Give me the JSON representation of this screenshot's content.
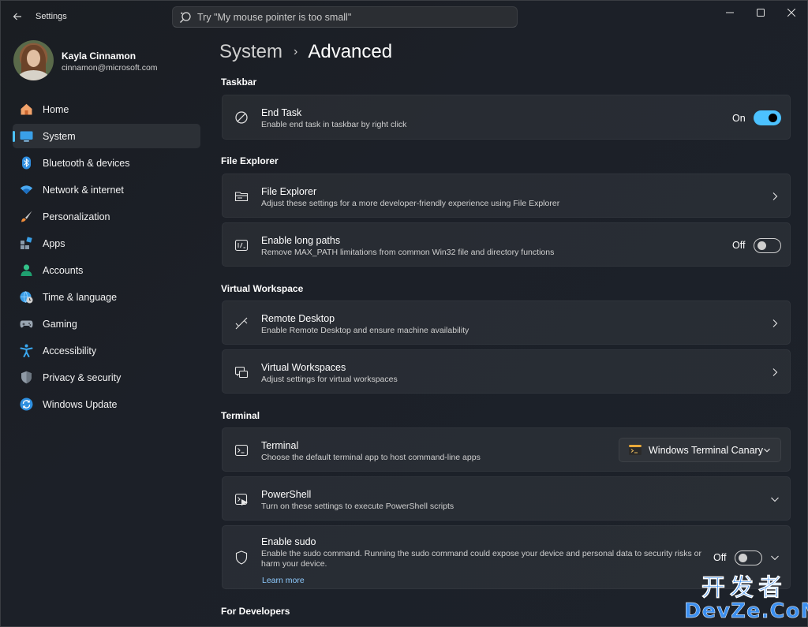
{
  "app": {
    "title": "Settings",
    "back_icon": "back-arrow-icon",
    "window_controls": [
      "minimize-icon",
      "maximize-icon",
      "close-icon"
    ]
  },
  "search": {
    "placeholder": "Try \"My mouse pointer is too small\"",
    "value": "",
    "icon": "search-icon"
  },
  "user": {
    "name": "Kayla Cinnamon",
    "email": "cinnamon@microsoft.com"
  },
  "nav": {
    "selected": "System",
    "items": [
      {
        "label": "Home",
        "icon": "home-icon"
      },
      {
        "label": "System",
        "icon": "system-display-icon"
      },
      {
        "label": "Bluetooth & devices",
        "icon": "bluetooth-icon"
      },
      {
        "label": "Network & internet",
        "icon": "wifi-icon"
      },
      {
        "label": "Personalization",
        "icon": "paintbrush-icon"
      },
      {
        "label": "Apps",
        "icon": "apps-icon"
      },
      {
        "label": "Accounts",
        "icon": "accounts-icon"
      },
      {
        "label": "Time & language",
        "icon": "globe-clock-icon"
      },
      {
        "label": "Gaming",
        "icon": "gamepad-icon"
      },
      {
        "label": "Accessibility",
        "icon": "accessibility-icon"
      },
      {
        "label": "Privacy & security",
        "icon": "shield-icon"
      },
      {
        "label": "Windows Update",
        "icon": "windows-update-icon"
      }
    ]
  },
  "breadcrumb": {
    "parent": "System",
    "separator": "›",
    "current": "Advanced"
  },
  "sections": {
    "taskbar": "Taskbar",
    "file_explorer": "File Explorer",
    "virtual_workspace": "Virtual Workspace",
    "terminal": "Terminal",
    "for_developers": "For Developers"
  },
  "cards": {
    "end_task": {
      "title": "End Task",
      "desc": "Enable end task in taskbar by right click",
      "state": "On",
      "on": true
    },
    "file_explorer": {
      "title": "File Explorer",
      "desc": "Adjust these settings for a more developer-friendly experience using File Explorer"
    },
    "long_paths": {
      "title": "Enable long paths",
      "desc": "Remove MAX_PATH limitations from common Win32 file and directory functions",
      "state": "Off",
      "on": false
    },
    "remote_desktop": {
      "title": "Remote Desktop",
      "desc": "Enable Remote Desktop and ensure machine availability"
    },
    "virtual_workspaces": {
      "title": "Virtual Workspaces",
      "desc": "Adjust settings for virtual workspaces"
    },
    "terminal": {
      "title": "Terminal",
      "desc": "Choose the default terminal app to host command-line apps",
      "dropdown_value": "Windows Terminal Canary"
    },
    "powershell": {
      "title": "PowerShell",
      "desc": "Turn on these settings to execute PowerShell scripts"
    },
    "sudo": {
      "title": "Enable sudo",
      "desc": "Enable the sudo command. Running the sudo command could expose your device and personal data to security risks or harm your device.",
      "link": "Learn more",
      "state": "Off",
      "on": false
    }
  },
  "watermark": {
    "line1": "开发者",
    "line2": "DevZe.CoM"
  },
  "colors": {
    "accent": "#4cc2ff",
    "background": "#1c2028",
    "card": "#272a30",
    "link": "#8ecbff"
  }
}
